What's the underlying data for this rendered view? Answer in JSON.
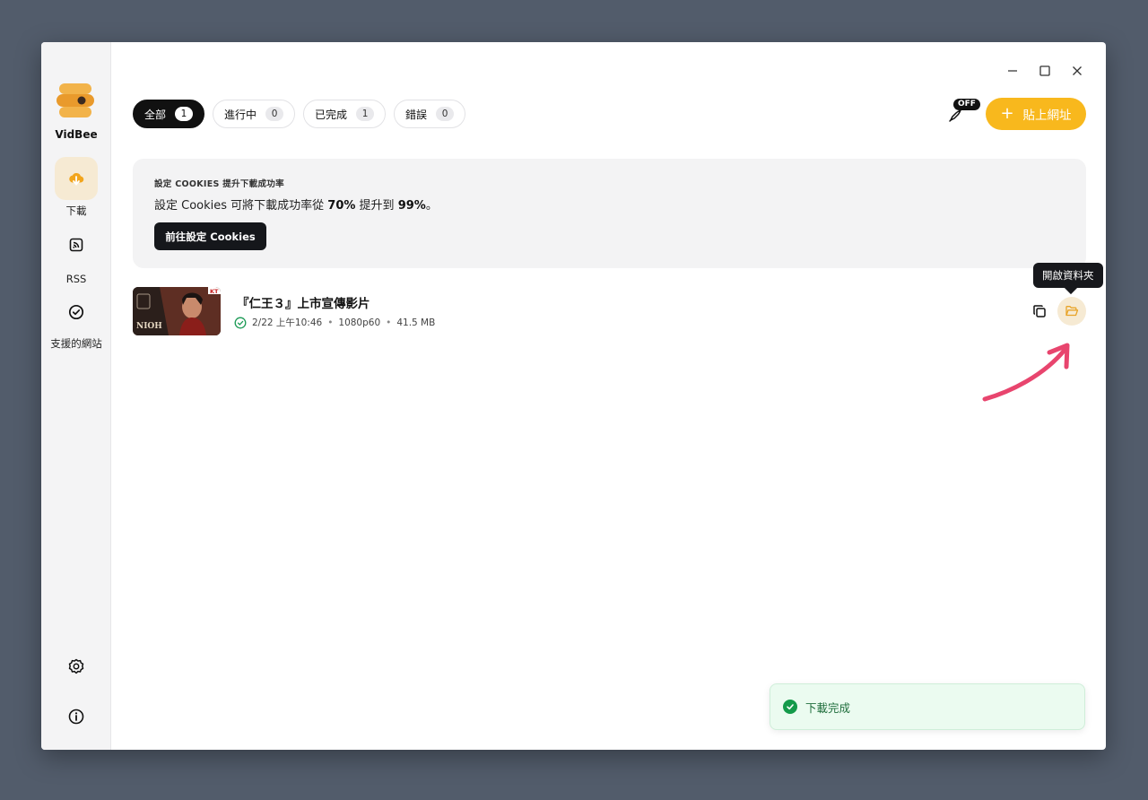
{
  "app": {
    "name": "VidBee"
  },
  "sidebar": {
    "items": [
      {
        "label": "下載",
        "icon": "download-cloud-icon"
      },
      {
        "label": "RSS",
        "icon": "rss-icon"
      },
      {
        "label": "支援的網站",
        "icon": "check-circle-icon"
      }
    ],
    "bottom": [
      {
        "icon": "settings-gear-icon"
      },
      {
        "icon": "info-icon"
      }
    ]
  },
  "tabs": [
    {
      "label": "全部",
      "count": "1"
    },
    {
      "label": "進行中",
      "count": "0"
    },
    {
      "label": "已完成",
      "count": "1"
    },
    {
      "label": "錯誤",
      "count": "0"
    }
  ],
  "toolbar": {
    "off_badge": "OFF",
    "paste_label": "貼上網址"
  },
  "banner": {
    "title": "設定 COOKIES 提升下載成功率",
    "text_1": "設定 Cookies 可將下載成功率從 ",
    "from_rate": "70%",
    "text_2": " 提升到 ",
    "to_rate": "99%",
    "text_3": "。",
    "button": "前往設定 Cookies"
  },
  "download": {
    "title": "『仁王３』上市宣傳影片",
    "date": "2/22 上午10:46",
    "quality": "1080p60",
    "size": "41.5 MB",
    "separator": "•",
    "thumb_text": "NIOH",
    "thumb_badge": "KT"
  },
  "tooltip": "開啟資料夾",
  "toast": {
    "message": "下載完成"
  },
  "colors": {
    "accent": "#f8b81d",
    "success": "#149a4a",
    "arrow": "#e8456e"
  }
}
